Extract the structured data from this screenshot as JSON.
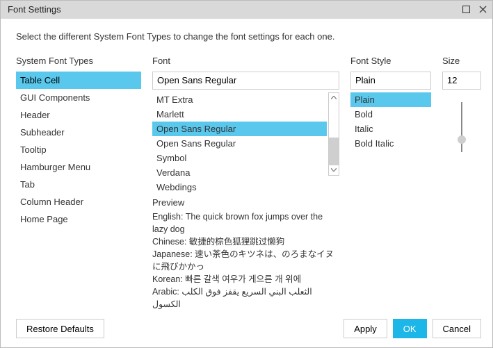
{
  "title": "Font Settings",
  "intro": "Select the different System Font Types to change the font settings for each one.",
  "headers": {
    "types": "System Font Types",
    "font": "Font",
    "style": "Font Style",
    "size": "Size",
    "preview": "Preview"
  },
  "type_list": {
    "selected": 0,
    "items": [
      "Table Cell",
      "GUI Components",
      "Header",
      "Subheader",
      "Tooltip",
      "Hamburger Menu",
      "Tab",
      "Column Header",
      "Home Page"
    ]
  },
  "font_value": "Open Sans Regular",
  "font_options": {
    "selected": 2,
    "items": [
      "MT Extra",
      "Marlett",
      "Open Sans Regular",
      "Open Sans Regular",
      "Symbol",
      "Verdana",
      "Webdings"
    ]
  },
  "style_value": "Plain",
  "style_options": {
    "selected": 0,
    "items": [
      "Plain",
      "Bold",
      "Italic",
      "Bold Italic"
    ]
  },
  "size_value": "12",
  "preview": {
    "en": "English: The quick brown fox jumps over the lazy dog",
    "zh": "Chinese: 敏捷的棕色狐狸跳过懒狗",
    "ja": "Japanese: 速い茶色のキツネは、のろまなイヌに飛びかかっ",
    "ko": "Korean: 빠른 갈색 여우가 게으른 개 위에",
    "ar": "Arabic: الثعلب البني السريع يقفز فوق الكلب الكسول"
  },
  "buttons": {
    "restore": "Restore Defaults",
    "apply": "Apply",
    "ok": "OK",
    "cancel": "Cancel"
  }
}
